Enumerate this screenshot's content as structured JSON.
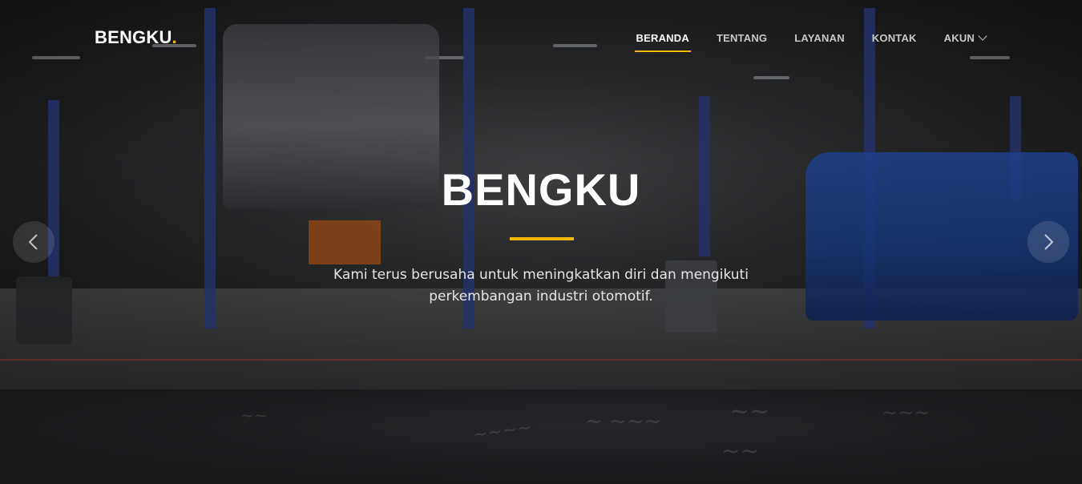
{
  "brand": {
    "name": "BENGKU",
    "dot": ".",
    "accent_color": "#f2b705"
  },
  "nav": {
    "items": [
      {
        "label": "BERANDA",
        "active": true
      },
      {
        "label": "TENTANG",
        "active": false
      },
      {
        "label": "LAYANAN",
        "active": false
      },
      {
        "label": "KONTAK",
        "active": false
      },
      {
        "label": "AKUN",
        "active": false,
        "dropdown": true
      }
    ]
  },
  "hero": {
    "title": "BENGKU",
    "subtitle_line1": "Kami terus berusaha untuk meningkatkan diri dan mengikuti",
    "subtitle_line2": "perkembangan industri otomotif.",
    "prev_icon": "chevron-left-icon",
    "next_icon": "chevron-right-icon"
  }
}
